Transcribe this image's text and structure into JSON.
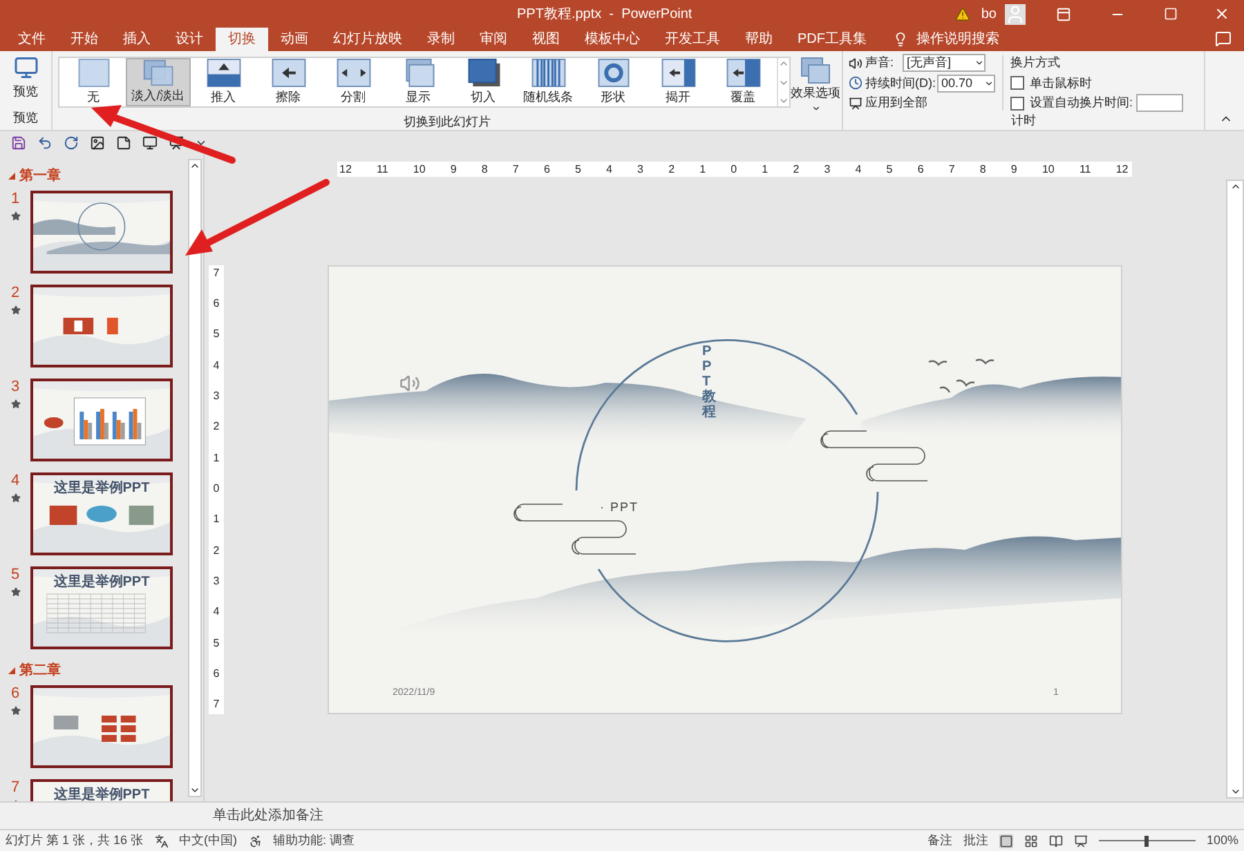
{
  "window": {
    "title": "PPT教程.pptx  -  PowerPoint",
    "user": "bo"
  },
  "tabs": [
    {
      "label": "文件",
      "selected": false
    },
    {
      "label": "开始",
      "selected": false
    },
    {
      "label": "插入",
      "selected": false
    },
    {
      "label": "设计",
      "selected": false
    },
    {
      "label": "切换",
      "selected": true
    },
    {
      "label": "动画",
      "selected": false
    },
    {
      "label": "幻灯片放映",
      "selected": false
    },
    {
      "label": "录制",
      "selected": false
    },
    {
      "label": "审阅",
      "selected": false
    },
    {
      "label": "视图",
      "selected": false
    },
    {
      "label": "模板中心",
      "selected": false
    },
    {
      "label": "开发工具",
      "selected": false
    },
    {
      "label": "帮助",
      "selected": false
    },
    {
      "label": "PDF工具集",
      "selected": false
    }
  ],
  "tell_me": "操作说明搜索",
  "ribbon": {
    "preview": {
      "button": "预览",
      "group_label": "预览"
    },
    "transitions": {
      "items": [
        {
          "label": "无",
          "kind": "none",
          "selected": false
        },
        {
          "label": "淡入/淡出",
          "kind": "fade",
          "selected": true
        },
        {
          "label": "推入",
          "kind": "push",
          "selected": false
        },
        {
          "label": "擦除",
          "kind": "wipe",
          "selected": false
        },
        {
          "label": "分割",
          "kind": "split",
          "selected": false
        },
        {
          "label": "显示",
          "kind": "reveal",
          "selected": false
        },
        {
          "label": "切入",
          "kind": "cut",
          "selected": false
        },
        {
          "label": "随机线条",
          "kind": "bars",
          "selected": false
        },
        {
          "label": "形状",
          "kind": "shape",
          "selected": false
        },
        {
          "label": "揭开",
          "kind": "uncover",
          "selected": false
        },
        {
          "label": "覆盖",
          "kind": "cover",
          "selected": false
        }
      ],
      "effect_options": "效果选项",
      "group_label": "切换到此幻灯片"
    },
    "timing": {
      "sound_label": "声音:",
      "sound_value": "[无声音]",
      "duration_label": "持续时间(D):",
      "duration_value": "00.70",
      "apply_all": "应用到全部",
      "advance_title": "换片方式",
      "on_click": {
        "label": "单击鼠标时",
        "checked": false
      },
      "after": {
        "label": "设置自动换片时间:",
        "checked": false
      },
      "group_label": "计时"
    }
  },
  "slides_panel": {
    "sections": [
      {
        "title": "第一章",
        "expanded": true,
        "slides": [
          {
            "number": "1",
            "kind": "landscape",
            "selected": true
          },
          {
            "number": "2",
            "kind": "logos",
            "selected": true
          },
          {
            "number": "3",
            "kind": "chart",
            "selected": true
          },
          {
            "number": "4",
            "kind": "icons",
            "selected": true,
            "title": "这里是举例PPT"
          },
          {
            "number": "5",
            "kind": "table",
            "selected": true,
            "title": "这里是举例PPT"
          }
        ]
      },
      {
        "title": "第二章",
        "expanded": true,
        "slides": [
          {
            "number": "6",
            "kind": "grid",
            "selected": true
          },
          {
            "number": "7",
            "kind": "text",
            "selected": true,
            "title": "这里是举例PPT"
          }
        ]
      }
    ]
  },
  "ruler": {
    "horizontal": [
      "12",
      "11",
      "10",
      "9",
      "8",
      "7",
      "6",
      "5",
      "4",
      "3",
      "2",
      "1",
      "0",
      "1",
      "2",
      "3",
      "4",
      "5",
      "6",
      "7",
      "8",
      "9",
      "10",
      "11",
      "12"
    ],
    "vertical": [
      "7",
      "6",
      "5",
      "4",
      "3",
      "2",
      "1",
      "0",
      "1",
      "2",
      "3",
      "4",
      "5",
      "6",
      "7"
    ]
  },
  "slide": {
    "title": "PPT教程",
    "subtitle": "· PPT",
    "date": "2022/11/9",
    "page": "1"
  },
  "notes": {
    "placeholder": "单击此处添加备注"
  },
  "status_bar": {
    "slide_info": "幻灯片 第 1 张，共 16 张",
    "language": "中文(中国)",
    "accessibility": "辅助功能: 调查",
    "notes": "备注",
    "comments": "批注",
    "zoom": "100%",
    "zoom_slider": {
      "level": 0.5
    }
  }
}
